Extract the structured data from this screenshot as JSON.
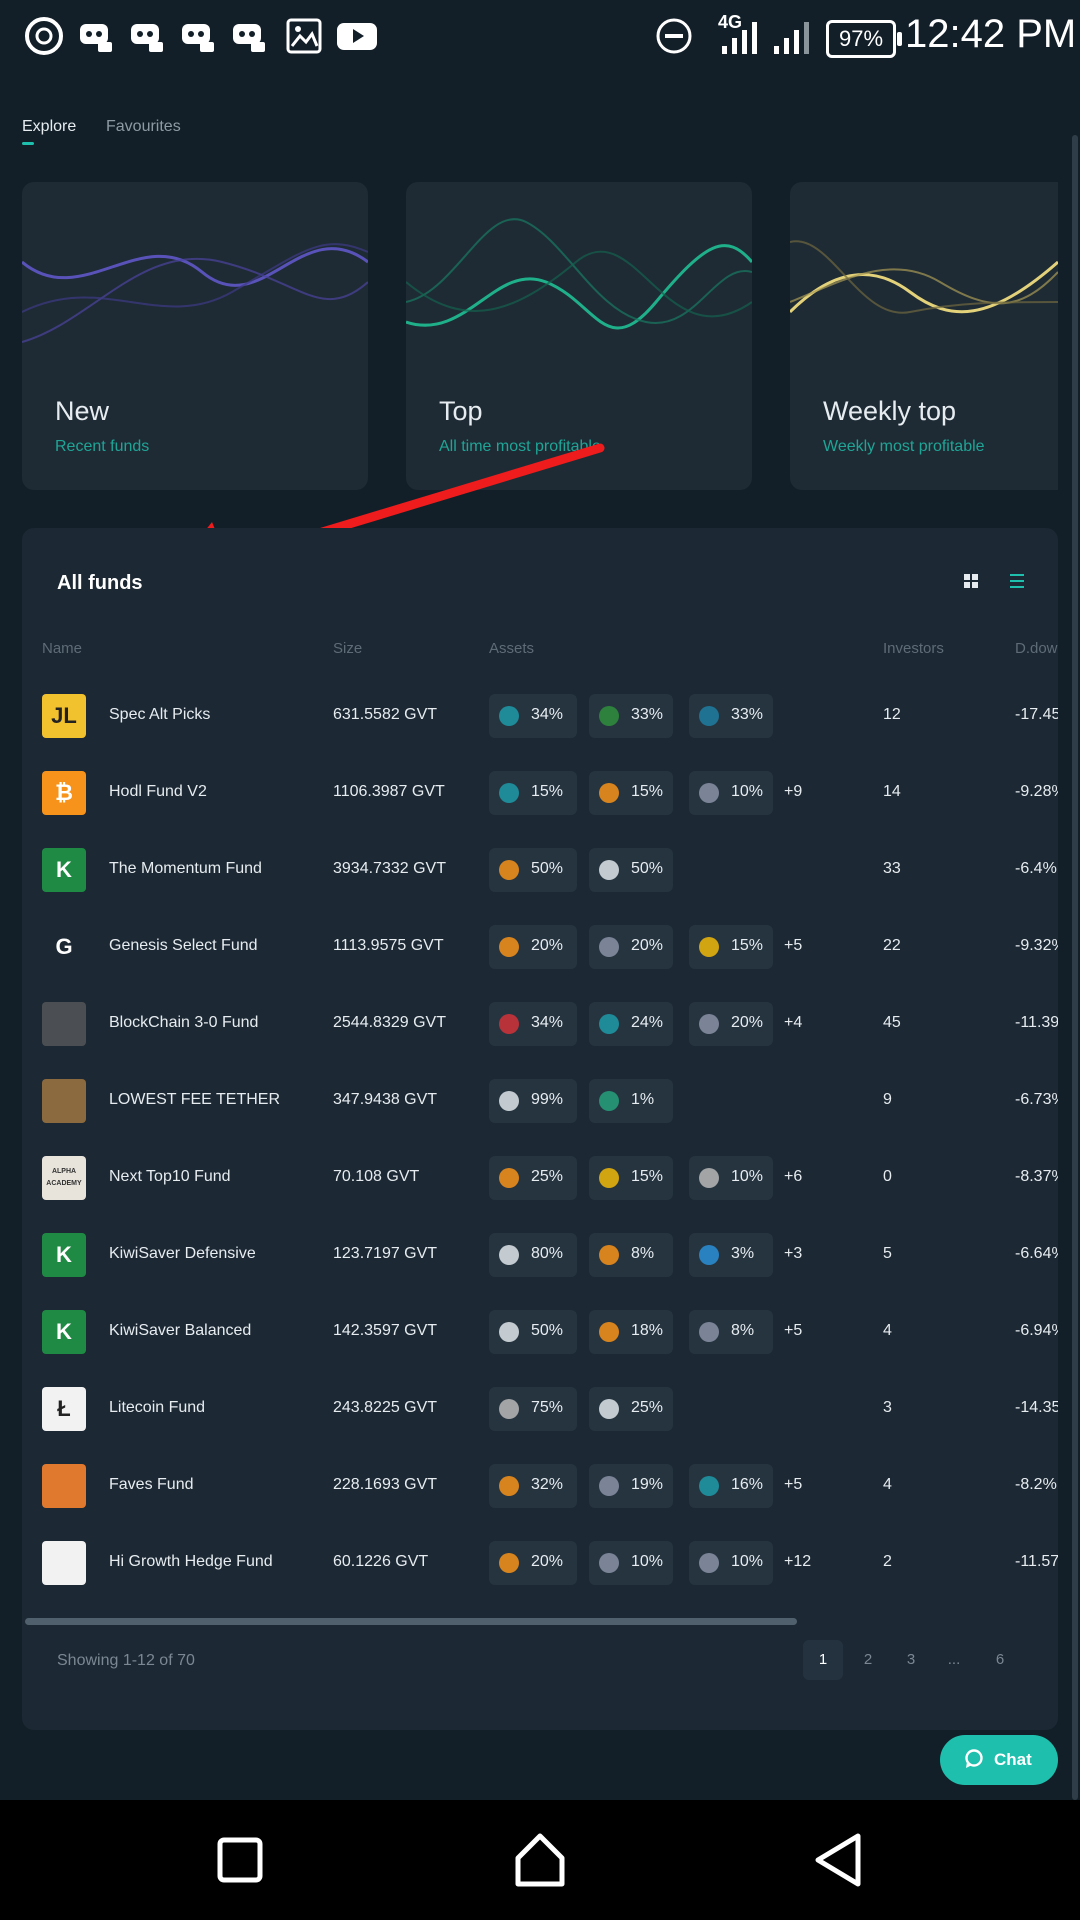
{
  "status_bar": {
    "time": "12:42 PM",
    "battery": "97%",
    "network": "4G",
    "icons": [
      "chrome-icon",
      "discord-icon",
      "discord-icon",
      "discord-icon",
      "discord-icon",
      "gallery-icon",
      "youtube-icon",
      "dnd-icon",
      "signal-icon",
      "signal-icon"
    ]
  },
  "tabs": [
    {
      "label": "Explore",
      "active": true
    },
    {
      "label": "Favourites",
      "active": false
    }
  ],
  "cards": [
    {
      "title": "New",
      "subtitle": "Recent funds",
      "color": "#5f58c8"
    },
    {
      "title": "Top",
      "subtitle": "All time most profitable",
      "color": "#1fb08a"
    },
    {
      "title": "Weekly top",
      "subtitle": "Weekly most profitable",
      "color": "#e3d27a"
    }
  ],
  "panel": {
    "title": "All funds",
    "columns": {
      "name": "Name",
      "size": "Size",
      "assets": "Assets",
      "investors": "Investors",
      "drawdown": "D.dow"
    },
    "rows": [
      {
        "name": "Spec Alt Picks",
        "size": "631.5582 GVT",
        "assets": [
          {
            "pct": "34%",
            "icon": "#1f9aa8"
          },
          {
            "pct": "33%",
            "icon": "#2f8f3c"
          },
          {
            "pct": "33%",
            "icon": "#1f7ea0"
          }
        ],
        "more": "",
        "investors": "12",
        "drawdown": "-17.45",
        "avatar": "JL",
        "avatar_bg": "#f2c12e"
      },
      {
        "name": "Hodl Fund V2",
        "size": "1106.3987 GVT",
        "assets": [
          {
            "pct": "15%",
            "icon": "#1f9aa8"
          },
          {
            "pct": "15%",
            "icon": "#f7931a"
          },
          {
            "pct": "10%",
            "icon": "#8b93a7"
          }
        ],
        "more": "+9",
        "investors": "14",
        "drawdown": "-9.28%",
        "avatar": "₿",
        "avatar_bg": "#f7931a"
      },
      {
        "name": "The Momentum Fund",
        "size": "3934.7332 GVT",
        "assets": [
          {
            "pct": "50%",
            "icon": "#f7931a"
          },
          {
            "pct": "50%",
            "icon": "#dfe6ea"
          }
        ],
        "more": "",
        "investors": "33",
        "drawdown": "-6.4%",
        "avatar": "K",
        "avatar_bg": "#1f8a44"
      },
      {
        "name": "Genesis Select Fund",
        "size": "1113.9575 GVT",
        "assets": [
          {
            "pct": "20%",
            "icon": "#f7931a"
          },
          {
            "pct": "20%",
            "icon": "#8b93a7"
          },
          {
            "pct": "15%",
            "icon": "#f0b90b"
          }
        ],
        "more": "+5",
        "investors": "22",
        "drawdown": "-9.32%",
        "avatar": "G",
        "avatar_bg": "#1c2833"
      },
      {
        "name": "BlockChain 3-0 Fund",
        "size": "2544.8329 GVT",
        "assets": [
          {
            "pct": "34%",
            "icon": "#d2323a"
          },
          {
            "pct": "24%",
            "icon": "#1f9aa8"
          },
          {
            "pct": "20%",
            "icon": "#8b93a7"
          }
        ],
        "more": "+4",
        "investors": "45",
        "drawdown": "-11.39",
        "avatar": "",
        "avatar_bg": "#4b4f53"
      },
      {
        "name": "LOWEST FEE TETHER",
        "size": "347.9438 GVT",
        "assets": [
          {
            "pct": "99%",
            "icon": "#dfe6ea"
          },
          {
            "pct": "1%",
            "icon": "#26a17b"
          }
        ],
        "more": "",
        "investors": "9",
        "drawdown": "-6.73%",
        "avatar": "",
        "avatar_bg": "#8a6a3e"
      },
      {
        "name": "Next Top10 Fund",
        "size": "70.108 GVT",
        "assets": [
          {
            "pct": "25%",
            "icon": "#f7931a"
          },
          {
            "pct": "15%",
            "icon": "#f0b90b"
          },
          {
            "pct": "10%",
            "icon": "#b8b8b8"
          }
        ],
        "more": "+6",
        "investors": "0",
        "drawdown": "-8.37%",
        "avatar": "ALPHA ACADEMY",
        "avatar_bg": "#e8e4dc"
      },
      {
        "name": "KiwiSaver Defensive",
        "size": "123.7197 GVT",
        "assets": [
          {
            "pct": "80%",
            "icon": "#dfe6ea"
          },
          {
            "pct": "8%",
            "icon": "#f7931a"
          },
          {
            "pct": "3%",
            "icon": "#2c8fd6"
          }
        ],
        "more": "+3",
        "investors": "5",
        "drawdown": "-6.64%",
        "avatar": "K",
        "avatar_bg": "#1f8a44"
      },
      {
        "name": "KiwiSaver Balanced",
        "size": "142.3597 GVT",
        "assets": [
          {
            "pct": "50%",
            "icon": "#dfe6ea"
          },
          {
            "pct": "18%",
            "icon": "#f7931a"
          },
          {
            "pct": "8%",
            "icon": "#8b93a7"
          }
        ],
        "more": "+5",
        "investors": "4",
        "drawdown": "-6.94%",
        "avatar": "K",
        "avatar_bg": "#1f8a44"
      },
      {
        "name": "Litecoin Fund",
        "size": "243.8225 GVT",
        "assets": [
          {
            "pct": "75%",
            "icon": "#b8b8b8"
          },
          {
            "pct": "25%",
            "icon": "#dfe6ea"
          }
        ],
        "more": "",
        "investors": "3",
        "drawdown": "-14.35",
        "avatar": "Ł",
        "avatar_bg": "#f2f2f2"
      },
      {
        "name": "Faves Fund",
        "size": "228.1693 GVT",
        "assets": [
          {
            "pct": "32%",
            "icon": "#f7931a"
          },
          {
            "pct": "19%",
            "icon": "#8b93a7"
          },
          {
            "pct": "16%",
            "icon": "#1f9aa8"
          }
        ],
        "more": "+5",
        "investors": "4",
        "drawdown": "-8.2%",
        "avatar": "",
        "avatar_bg": "#e0782e"
      },
      {
        "name": "Hi Growth Hedge Fund",
        "size": "60.1226 GVT",
        "assets": [
          {
            "pct": "20%",
            "icon": "#f7931a"
          },
          {
            "pct": "10%",
            "icon": "#8b93a7"
          },
          {
            "pct": "10%",
            "icon": "#8b93a7"
          }
        ],
        "more": "+12",
        "investors": "2",
        "drawdown": "-11.57",
        "avatar": "",
        "avatar_bg": "#f2f2f2"
      }
    ],
    "showing": "Showing 1-12 of 70",
    "pages": [
      "1",
      "2",
      "3",
      "...",
      "6"
    ],
    "current_page": "1"
  },
  "chat": {
    "label": "Chat"
  },
  "colors": {
    "accent": "#1fbfad",
    "background": "#131f28",
    "panel": "#1c2833"
  }
}
